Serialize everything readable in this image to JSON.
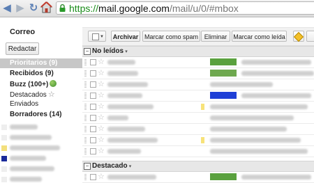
{
  "browser": {
    "url_scheme": "https://",
    "url_host": "mail.google.com",
    "url_path": "/mail/u/0/#mbox"
  },
  "sidebar": {
    "app_label": "Correo",
    "compose_label": "Redactar",
    "items": [
      {
        "label": "Prioritarios (9)"
      },
      {
        "label": "Recibidos (9)"
      },
      {
        "label": "Buzz (100+)"
      },
      {
        "label": "Destacados"
      },
      {
        "label": "Enviados"
      },
      {
        "label": "Borradores (14)"
      }
    ]
  },
  "toolbar": {
    "archive_label": "Archivar",
    "spam_label": "Marcar como spam",
    "delete_label": "Eliminar",
    "read_label": "Marcar como leída"
  },
  "sections": {
    "unread_label": "No leídos",
    "starred_label": "Destacado"
  },
  "colors": {
    "tag_green": "#5aa13e",
    "tag_blue": "#1f3fd6",
    "important_yellow": "#f7e27a",
    "chat_yellow": "#f3df7c",
    "chat_navy": "#1a2a9a"
  }
}
